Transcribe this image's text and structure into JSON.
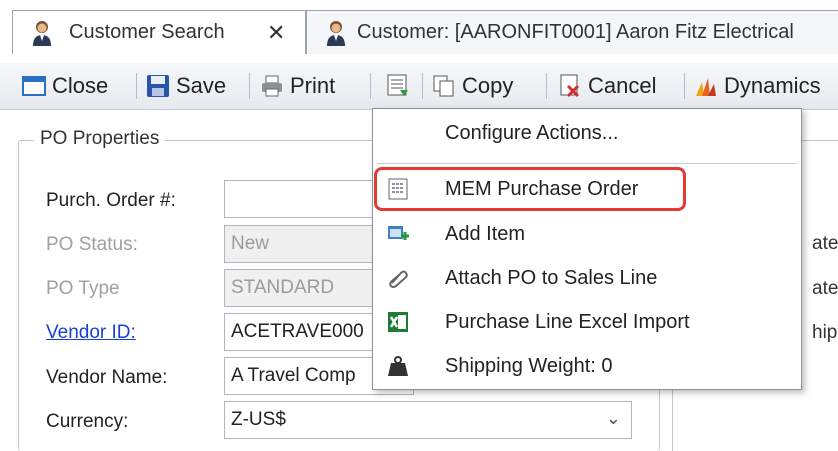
{
  "tabs": [
    {
      "label": "Customer Search",
      "close": "✕"
    },
    {
      "label": "Customer: [AARONFIT0001] Aaron Fitz Electrical"
    }
  ],
  "toolbar": {
    "close": "Close",
    "save": "Save",
    "print": "Print",
    "copy": "Copy",
    "cancel": "Cancel",
    "dynamics": "Dynamics"
  },
  "group": {
    "title": "PO Properties"
  },
  "fields": {
    "po_number": {
      "label": "Purch. Order #:",
      "value": ""
    },
    "po_status": {
      "label": "PO Status:",
      "value": "New"
    },
    "po_type": {
      "label": "PO Type",
      "value": "STANDARD"
    },
    "vendor_id": {
      "label": "Vendor ID:",
      "value": "ACETRAVE000"
    },
    "vendor_name": {
      "label": "Vendor Name:",
      "value": "A Travel Comp"
    },
    "currency": {
      "label": "Currency:",
      "value": "Z-US$"
    }
  },
  "right_fragments": [
    "ate",
    "ate",
    "hips"
  ],
  "menu": {
    "items": [
      {
        "label": "Configure Actions...",
        "icon": "none"
      },
      {
        "label": "MEM Purchase Order",
        "icon": "document-grid-icon"
      },
      {
        "label": "Add Item",
        "icon": "add-item-icon"
      },
      {
        "label": "Attach PO to Sales Line",
        "icon": "paperclip-icon"
      },
      {
        "label": "Purchase Line Excel Import",
        "icon": "excel-icon"
      },
      {
        "label": "Shipping Weight: 0",
        "icon": "weight-icon"
      }
    ]
  },
  "colors": {
    "highlight": "#e53935",
    "link": "#1a3fd6",
    "excel_green": "#1f7a36"
  }
}
